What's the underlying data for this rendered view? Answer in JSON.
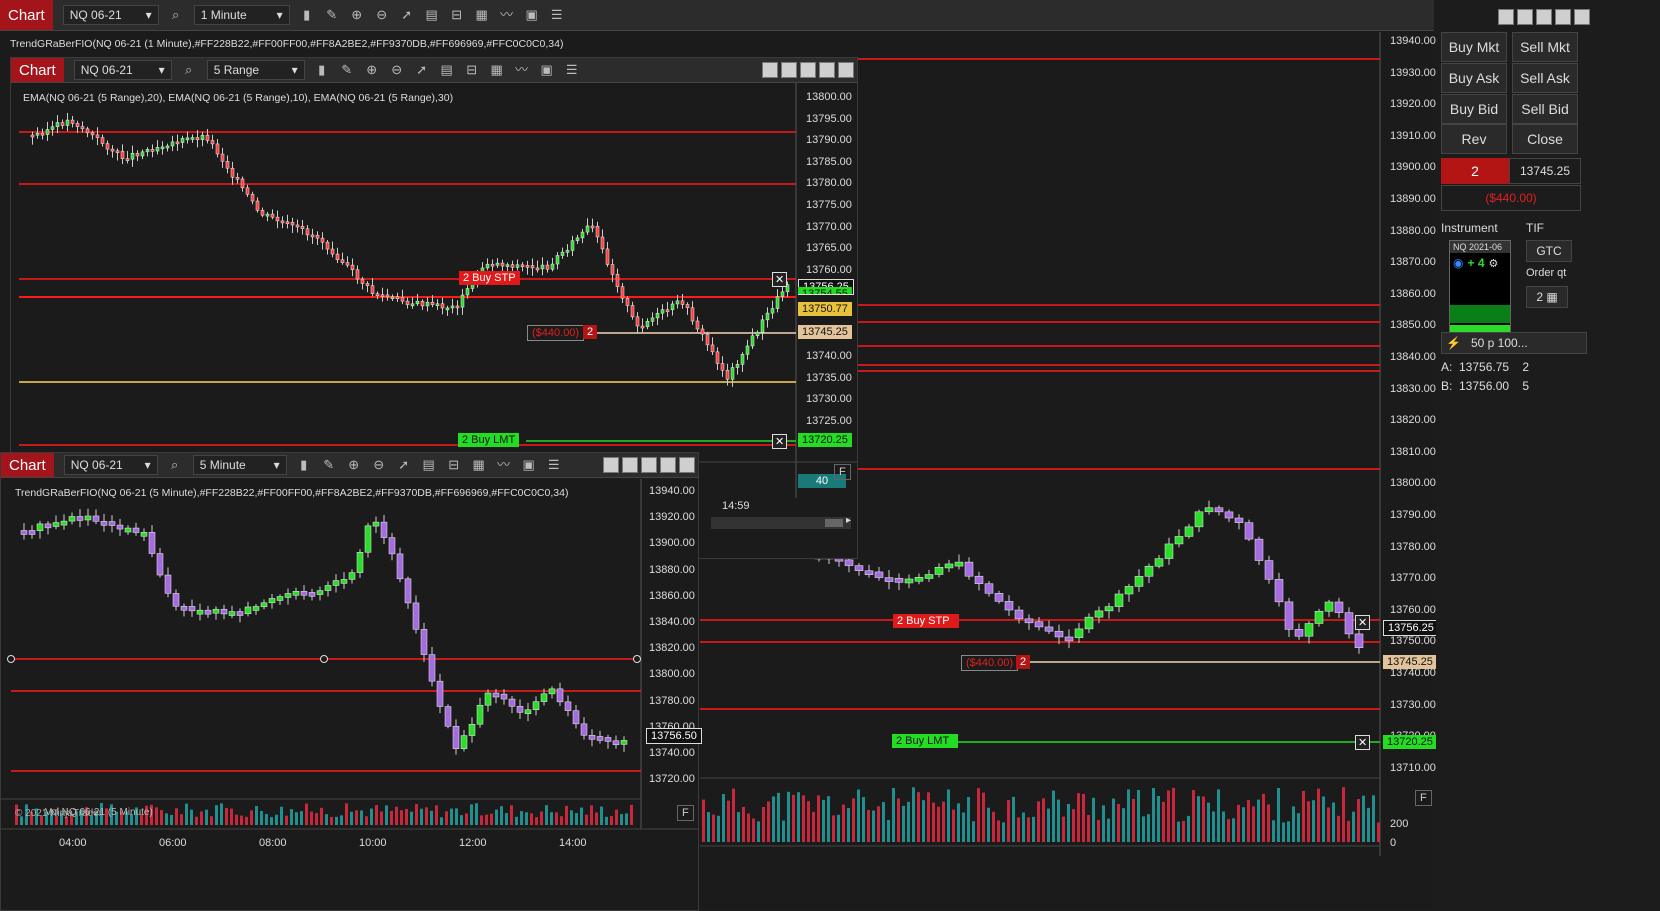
{
  "main": {
    "chart_label": "Chart",
    "instrument": "NQ 06-21",
    "interval": "1 Minute",
    "indicator": "TrendGRaBerFIO(NQ 06-21 (1 Minute),#FF228B22,#FF00FF00,#FF8A2BE2,#FF9370DB,#FF696969,#FFC0C0C0,34)",
    "price_axis": [
      "13940.00",
      "13930.00",
      "13920.00",
      "13910.00",
      "13900.00",
      "13890.00",
      "13880.00",
      "13870.00",
      "13860.00",
      "13850.00",
      "13840.00",
      "13830.00",
      "13820.00",
      "13810.00",
      "13800.00",
      "13790.00",
      "13780.00",
      "13770.00",
      "13760.00",
      "13750.00",
      "13740.00",
      "13730.00",
      "13720.00",
      "13710.00"
    ],
    "price_tags": {
      "last": "13756.25",
      "position": "13745.25",
      "limit": "13720.25"
    },
    "buy_stp": "2  Buy STP",
    "buy_lmt": "2  Buy LMT",
    "pnl": "($440.00)",
    "qty": "2",
    "vol_axis": [
      "200",
      "0"
    ],
    "time_label": "14:59",
    "f_label": "F"
  },
  "w5r": {
    "chart_label": "Chart",
    "instrument": "NQ 06-21",
    "interval": "5 Range",
    "indicator": "EMA(NQ 06-21 (5 Range),20), EMA(NQ 06-21 (5 Range),10), EMA(NQ 06-21 (5 Range),30)",
    "price_axis": [
      "13800.00",
      "13795.00",
      "13790.00",
      "13785.00",
      "13780.00",
      "13775.00",
      "13770.00",
      "13765.00",
      "13760.00",
      "13755.00",
      "13750.00",
      "13745.00",
      "13740.00",
      "13735.00",
      "13730.00",
      "13725.00",
      "13720.00"
    ],
    "tags": {
      "last": "13756.25",
      "ema": "13754.55",
      "ema2": "13750.77",
      "position": "13745.25",
      "limit": "13720.25",
      "vol": "40"
    },
    "buy_stp": "2  Buy STP",
    "buy_lmt": "2  Buy LMT",
    "pnl": "($440.00)",
    "qty": "2",
    "f_label": "F"
  },
  "w5m": {
    "chart_label": "Chart",
    "instrument": "NQ 06-21",
    "interval": "5 Minute",
    "indicator": "TrendGRaBerFIO(NQ 06-21 (5 Minute),#FF228B22,#FF00FF00,#FF8A2BE2,#FF9370DB,#FF696969,#FFC0C0C0,34)",
    "price_axis": [
      "13940.00",
      "13920.00",
      "13900.00",
      "13880.00",
      "13860.00",
      "13840.00",
      "13820.00",
      "13800.00",
      "13780.00",
      "13760.00",
      "13740.00",
      "13720.00"
    ],
    "last_tag": "13756.50",
    "time_axis": [
      "04:00",
      "06:00",
      "08:00",
      "10:00",
      "12:00",
      "14:00"
    ],
    "watermark": "© 2021 NinjaTrader",
    "vol_label": "Vol NQ 06-21 (5 Minute)",
    "f_label": "F"
  },
  "order_panel": {
    "buy_mkt": "Buy Mkt",
    "sell_mkt": "Sell Mkt",
    "buy_ask": "Buy Ask",
    "sell_ask": "Sell Ask",
    "buy_bid": "Buy Bid",
    "sell_bid": "Sell Bid",
    "rev": "Rev",
    "close": "Close",
    "position_qty": "2",
    "position_price": "13745.25",
    "unrealized": "($440.00)",
    "instrument_label": "Instrument",
    "tif_label": "TIF",
    "instrument_value": "NQ 2021-06",
    "tif_value": "GTC",
    "order_qty_label": "Order qt",
    "order_qty_value": "2",
    "popup_count": "+ 4",
    "atm_value": "50 p 100...",
    "ask_line": "A:  13756.75    2",
    "bid_line": "B:  13756.00    5"
  },
  "colors": {
    "bg": "#1b1b1b",
    "red_line": "#ff1a1a",
    "up": "#2bdc2b",
    "down": "#a56be0",
    "gold": "#e8c23a"
  }
}
